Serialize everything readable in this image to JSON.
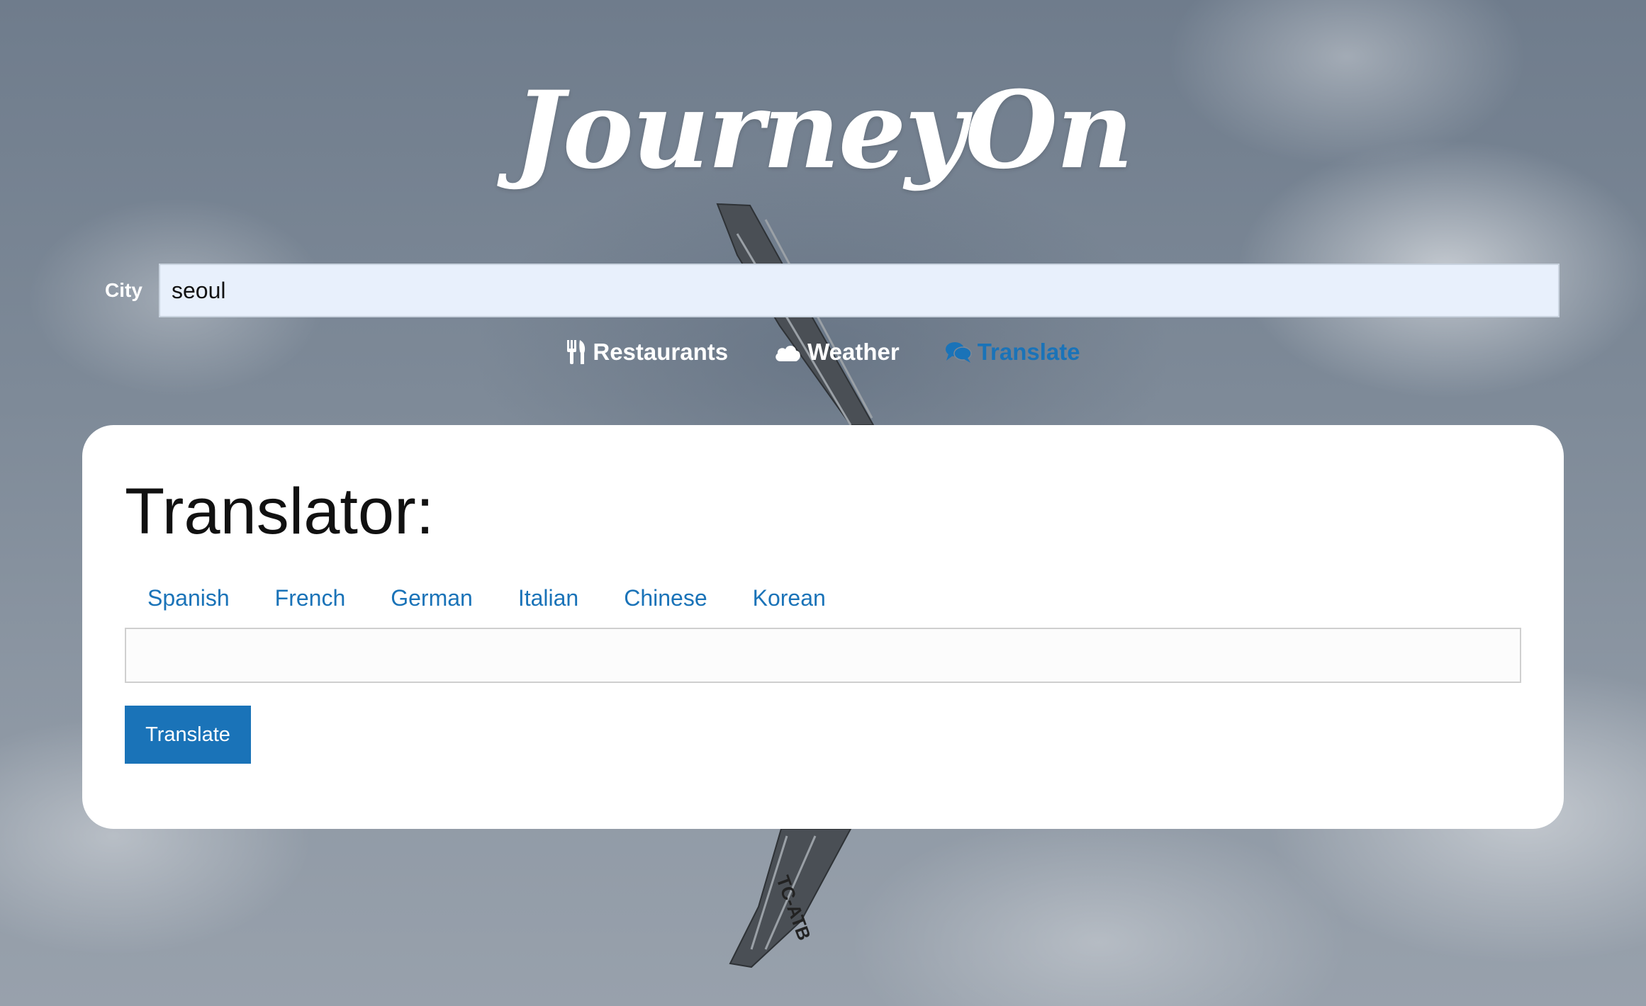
{
  "app": {
    "logo_text": "JourneyOn"
  },
  "search": {
    "city_label": "City",
    "city_value": "seoul"
  },
  "nav": {
    "items": [
      {
        "label": "Restaurants",
        "icon": "utensils-icon",
        "active": false
      },
      {
        "label": "Weather",
        "icon": "cloud-icon",
        "active": false
      },
      {
        "label": "Translate",
        "icon": "comments-icon",
        "active": true
      }
    ]
  },
  "translator": {
    "title": "Translator:",
    "languages": [
      "Spanish",
      "French",
      "German",
      "Italian",
      "Chinese",
      "Korean"
    ],
    "input_value": "",
    "button_label": "Translate"
  },
  "colors": {
    "accent": "#1a73b8",
    "panel_background": "#ffffff",
    "city_input_background": "#e8f0fc"
  }
}
